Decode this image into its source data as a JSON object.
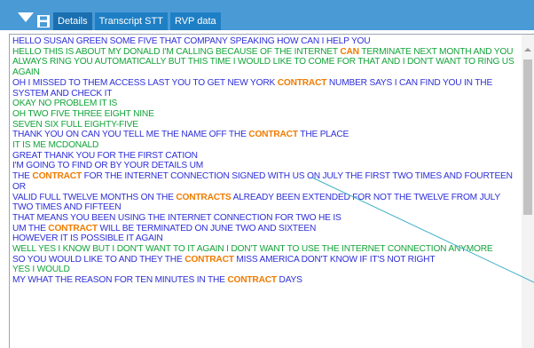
{
  "tabs": [
    {
      "label": "Details"
    },
    {
      "label": "Transcript STT"
    },
    {
      "label": "RVP data"
    }
  ],
  "transcript": [
    {
      "speaker": "agent",
      "parts": [
        {
          "t": "HELLO SUSAN GREEN SOME FIVE THAT COMPANY SPEAKING HOW CAN I HELP YOU"
        }
      ]
    },
    {
      "speaker": "customer",
      "parts": [
        {
          "t": "HELLO THIS IS ABOUT MY DONALD I'M CALLING BECAUSE OF THE INTERNET "
        },
        {
          "t": "CAN",
          "kw": true
        },
        {
          "t": " TERMINATE NEXT MONTH AND YOU ALWAYS RING YOU AUTOMATICALLY BUT THIS TIME I WOULD LIKE TO COME FOR THAT AND I DON'T WANT TO RING US AGAIN"
        }
      ]
    },
    {
      "speaker": "agent",
      "parts": [
        {
          "t": "OH I MISSED TO THEM ACCESS LAST YOU TO GET NEW YORK "
        },
        {
          "t": "CONTRACT",
          "kw": true
        },
        {
          "t": " NUMBER SAYS I CAN FIND YOU IN THE SYSTEM AND CHECK IT"
        }
      ]
    },
    {
      "speaker": "customer",
      "parts": [
        {
          "t": "OKAY NO PROBLEM IT IS"
        }
      ]
    },
    {
      "speaker": "customer",
      "parts": [
        {
          "t": "OH TWO FIVE THREE EIGHT NINE"
        }
      ]
    },
    {
      "speaker": "customer",
      "parts": [
        {
          "t": "SEVEN SIX FULL EIGHTY-FIVE"
        }
      ]
    },
    {
      "speaker": "agent",
      "parts": [
        {
          "t": "THANK YOU ON CAN YOU TELL ME THE NAME OFF THE "
        },
        {
          "t": "CONTRACT",
          "kw": true
        },
        {
          "t": " THE PLACE"
        }
      ]
    },
    {
      "speaker": "customer",
      "parts": [
        {
          "t": "IT IS ME MCDONALD"
        }
      ]
    },
    {
      "speaker": "agent",
      "parts": [
        {
          "t": "GREAT THANK YOU FOR THE FIRST CATION"
        }
      ]
    },
    {
      "speaker": "agent",
      "parts": [
        {
          "t": "I'M GOING TO FIND OR BY YOUR DETAILS UM"
        }
      ]
    },
    {
      "speaker": "agent",
      "parts": [
        {
          "t": "THE "
        },
        {
          "t": "CONTRACT",
          "kw": true
        },
        {
          "t": " FOR THE INTERNET CONNECTION SIGNED WITH US ON JULY THE FIRST TWO TIMES AND FOURTEEN OR"
        }
      ]
    },
    {
      "speaker": "agent",
      "parts": [
        {
          "t": "VALID FULL TWELVE MONTHS ON THE "
        },
        {
          "t": "CONTRACTS",
          "kw": true
        },
        {
          "t": " ALREADY BEEN EXTENDED FOR NOT THE TWELVE FROM JULY TWO TIMES AND FIFTEEN"
        }
      ]
    },
    {
      "speaker": "agent",
      "parts": [
        {
          "t": "THAT MEANS YOU BEEN USING THE INTERNET CONNECTION FOR TWO HE IS"
        }
      ]
    },
    {
      "speaker": "agent",
      "parts": [
        {
          "t": "UM THE "
        },
        {
          "t": "CONTRACT",
          "kw": true
        },
        {
          "t": " WILL BE TERMINATED ON JUNE TWO AND SIXTEEN"
        }
      ]
    },
    {
      "speaker": "agent",
      "parts": [
        {
          "t": "HOWEVER IT IS POSSIBLE IT AGAIN"
        }
      ]
    },
    {
      "speaker": "customer",
      "parts": [
        {
          "t": "WELL YES I KNOW BUT I DON'T WANT TO IT AGAIN I DON'T WANT TO USE THE INTERNET CONNECTION ANYMORE"
        }
      ]
    },
    {
      "speaker": "agent",
      "parts": [
        {
          "t": "SO YOU WOULD LIKE TO AND THEY THE "
        },
        {
          "t": "CONTRACT",
          "kw": true
        },
        {
          "t": " MISS AMERICA DON'T KNOW IF IT'S NOT RIGHT"
        }
      ]
    },
    {
      "speaker": "customer",
      "parts": [
        {
          "t": "YES I WOULD"
        }
      ]
    },
    {
      "speaker": "agent",
      "parts": [
        {
          "t": "MY WHAT THE REASON FOR TEN MINUTES IN THE "
        },
        {
          "t": "CONTRACT",
          "kw": true
        },
        {
          "t": " DAYS"
        }
      ]
    }
  ],
  "colors": {
    "header": "#4a9ad6",
    "tab": "#1e7fc4",
    "agent_text": "#2e2fd8",
    "customer_text": "#13a43a",
    "keyword": "#f07c00"
  },
  "icons": {
    "header_arrow": "chevron-down-icon",
    "save": "save-icon"
  }
}
